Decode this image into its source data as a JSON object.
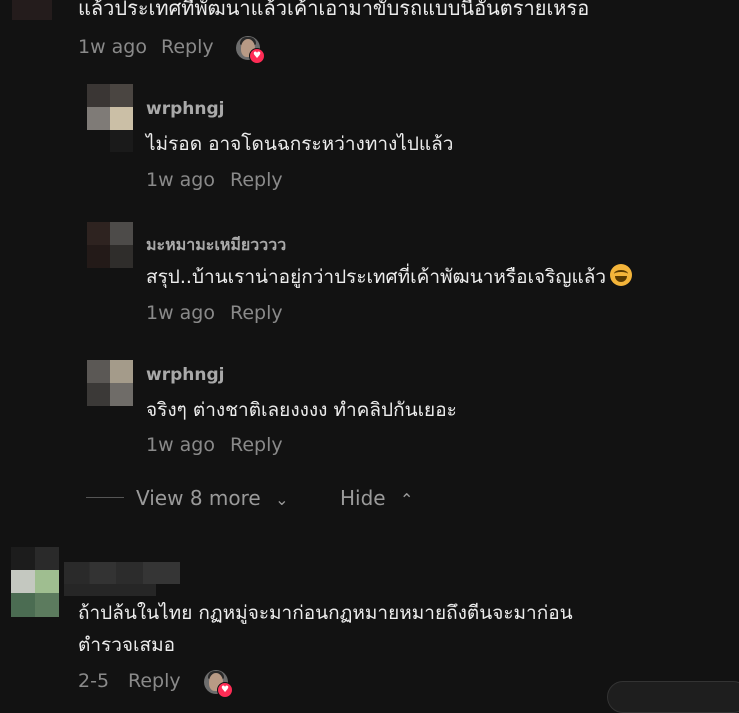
{
  "top_comment": {
    "text": "แล้วประเทศที่พัฒนาแล้วเค้าเอามาขับรถแบบนี้อันตรายเหรอ",
    "time": "1w ago",
    "reply_label": "Reply"
  },
  "replies": [
    {
      "username": "wrphngj",
      "text": "ไม่รอด อาจโดนฉกระหว่างทางไปแล้ว",
      "time": "1w ago",
      "reply_label": "Reply"
    },
    {
      "username": "มะหมามะเหมียวววว",
      "text": "สรุป..บ้านเราน่าอยู่กว่าประเทศที่เค้าพัฒนาหรือเจริญแล้ว",
      "emoji": "laughing-tears-emoji",
      "time": "1w ago",
      "reply_label": "Reply"
    },
    {
      "username": "wrphngj",
      "text": "จริงๆ ต่างชาติเลยงงงง ทำคลิปกันเยอะ",
      "time": "1w ago",
      "reply_label": "Reply"
    }
  ],
  "thread_controls": {
    "view_more_label": "View 8 more",
    "hide_label": "Hide"
  },
  "bottom_comment": {
    "text_line1": "ถ้าปล้นในไทย กฏหมู่จะมาก่อนกฏหมายหมายถึงตีนจะมาก่อน",
    "text_line2": "ตำรวจเสมอ",
    "time": "2-5",
    "reply_label": "Reply"
  },
  "colors": {
    "background": "#121212",
    "heart_badge": "#fe2c55"
  }
}
